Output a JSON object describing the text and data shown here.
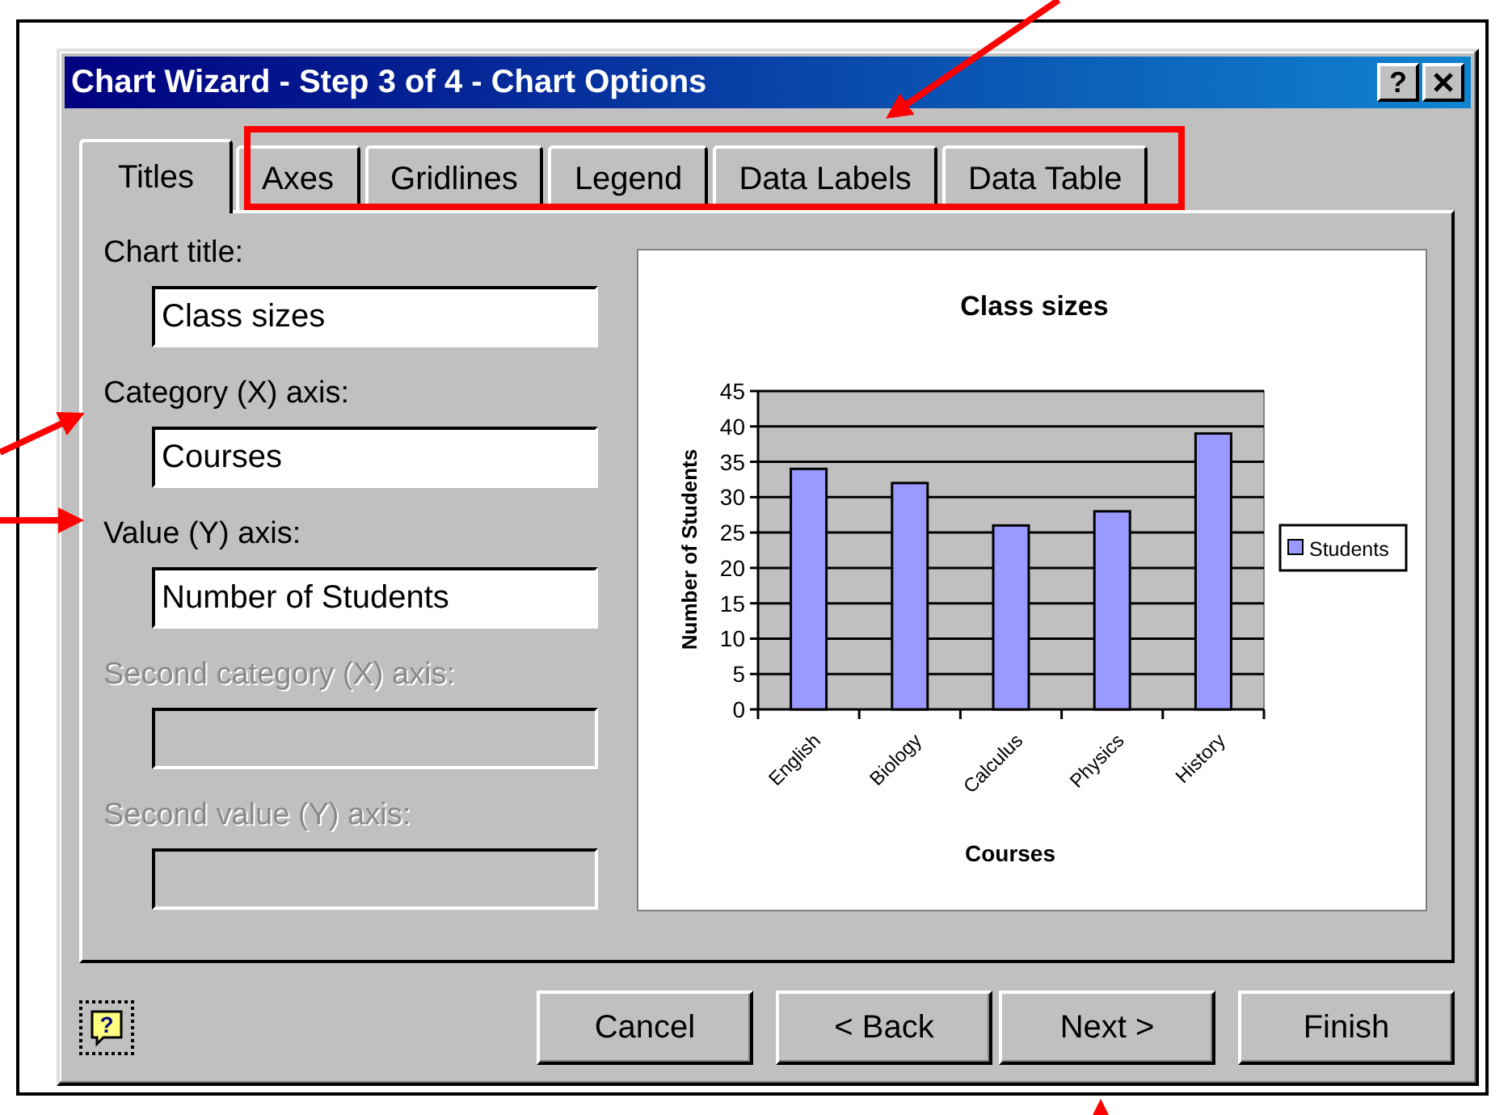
{
  "window": {
    "title": "Chart Wizard - Step 3 of 4 - Chart Options",
    "help_button": "?"
  },
  "tabs": [
    {
      "label": "Titles",
      "selected": true
    },
    {
      "label": "Axes",
      "selected": false
    },
    {
      "label": "Gridlines",
      "selected": false
    },
    {
      "label": "Legend",
      "selected": false
    },
    {
      "label": "Data Labels",
      "selected": false
    },
    {
      "label": "Data Table",
      "selected": false
    }
  ],
  "fields": [
    {
      "label": "Chart title:",
      "value": "Class sizes",
      "disabled": false
    },
    {
      "label": "Category (X) axis:",
      "value": "Courses",
      "disabled": false
    },
    {
      "label": "Value (Y) axis:",
      "value": "Number of Students",
      "disabled": false
    },
    {
      "label": "Second category (X) axis:",
      "disabled": true
    },
    {
      "label": "Second value (Y) axis:",
      "disabled": true
    }
  ],
  "preview": {
    "chart_data": {
      "type": "bar",
      "title": "Class sizes",
      "xlabel": "Courses",
      "ylabel": "Number of Students",
      "categories": [
        "English",
        "Biology",
        "Calculus",
        "Physics",
        "History"
      ],
      "series": [
        {
          "name": "Students",
          "color": "#9999ff",
          "values": [
            34,
            32,
            26,
            28,
            39
          ]
        }
      ],
      "grid": true,
      "ylim": [
        0,
        45
      ],
      "yticks": [
        0,
        5,
        10,
        15,
        20,
        25,
        30,
        35,
        40,
        45
      ]
    }
  },
  "buttons": [
    "Cancel",
    "< Back",
    "Next >",
    "Finish"
  ]
}
